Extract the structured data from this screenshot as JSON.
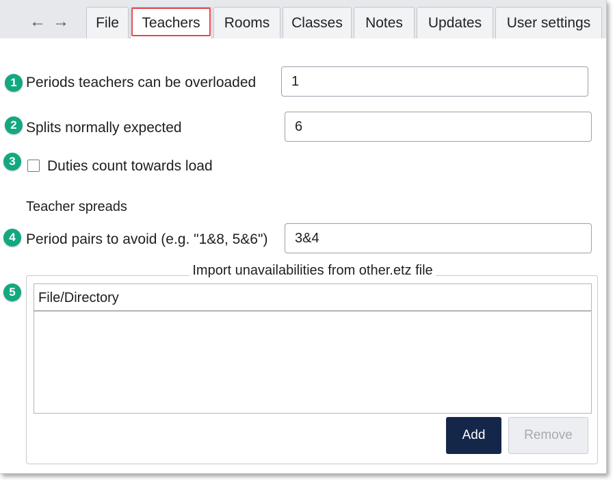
{
  "nav": {
    "back_glyph": "←",
    "forward_glyph": "→"
  },
  "tabs": [
    {
      "label": "File"
    },
    {
      "label": "Teachers",
      "active": true
    },
    {
      "label": "Rooms"
    },
    {
      "label": "Classes"
    },
    {
      "label": "Notes"
    },
    {
      "label": "Updates"
    },
    {
      "label": "User settings"
    }
  ],
  "form": {
    "overload": {
      "badge": "1",
      "label": "Periods teachers can be overloaded",
      "value": "1"
    },
    "splits": {
      "badge": "2",
      "label": "Splits normally expected",
      "value": "6"
    },
    "duties": {
      "badge": "3",
      "label": "Duties count towards load",
      "checked": false
    },
    "spreads_heading": "Teacher spreads",
    "period_pairs": {
      "badge": "4",
      "label": "Period pairs to avoid (e.g. \"1&8, 5&6\")",
      "value": "3&4"
    }
  },
  "import": {
    "badge": "5",
    "title": "Import unavailabilities from other.etz file",
    "column_header": "File/Directory",
    "rows": [],
    "add_label": "Add",
    "remove_label": "Remove"
  },
  "colors": {
    "badge": "#13a87f",
    "highlight": "#e0474c",
    "primary_button": "#14274a"
  }
}
